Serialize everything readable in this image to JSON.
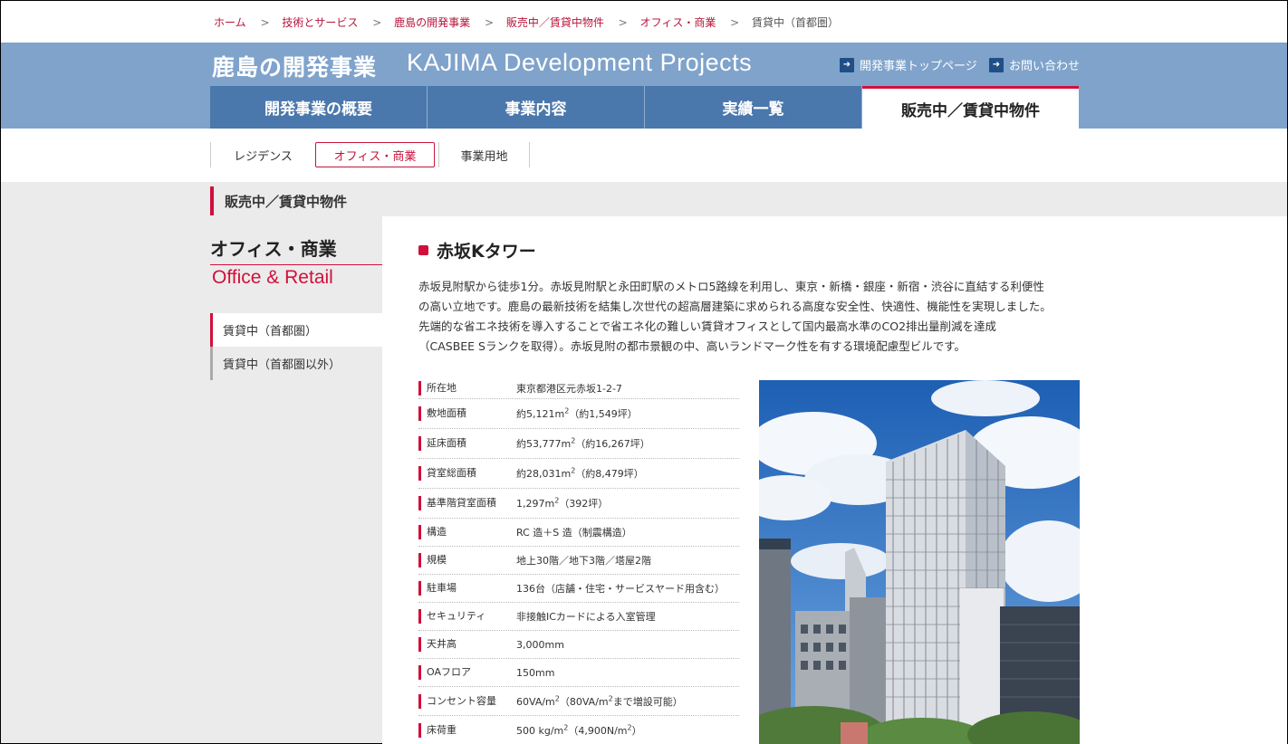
{
  "breadcrumb": {
    "items": [
      "ホーム",
      "技術とサービス",
      "鹿島の開発事業",
      "販売中／賃貸中物件",
      "オフィス・商業"
    ],
    "current": "賃貸中（首都圏）",
    "separator": ">"
  },
  "header": {
    "title_jp": "鹿島の開発事業",
    "title_en": "KAJIMA Development Projects",
    "links": [
      "開発事業トップページ",
      "お問い合わせ"
    ]
  },
  "global_nav": [
    "開発事業の概要",
    "事業内容",
    "実績一覧",
    "販売中／賃貸中物件"
  ],
  "sub_nav": [
    "レジデンス",
    "オフィス・商業",
    "事業用地"
  ],
  "section_heading": "販売中／賃貸中物件",
  "sidebar": {
    "title_jp": "オフィス・商業",
    "title_en": "Office & Retail",
    "items": [
      "賃貸中（首都圏）",
      "賃貸中（首都圏以外）"
    ]
  },
  "main": {
    "title": "赤坂Kタワー",
    "description": [
      "赤坂見附駅から徒歩1分。赤坂見附駅と永田町駅のメトロ5路線を利用し、東京・新橋・銀座・新宿・渋谷に直結する利便性",
      "の高い立地です。鹿島の最新技術を結集し次世代の超高層建築に求められる高度な安全性、快適性、機能性を実現しました。",
      "先端的な省エネ技術を導入することで省エネ化の難しい賃貸オフィスとして国内最高水準のCO2排出量削減を達成",
      "（CASBEE Sランクを取得）。赤坂見附の都市景観の中、高いランドマーク性を有する環境配慮型ビルです。"
    ],
    "specs": [
      {
        "key": "所在地",
        "val": "東京都港区元赤坂1-2-7"
      },
      {
        "key": "敷地面積",
        "pre": "約5,121m",
        "sup": "2",
        "post": "（約1,549坪）"
      },
      {
        "key": "延床面積",
        "pre": "約53,777m",
        "sup": "2",
        "post": "（約16,267坪）"
      },
      {
        "key": "貸室総面積",
        "pre": "約28,031m",
        "sup": "2",
        "post": "（約8,479坪）"
      },
      {
        "key": "基準階貸室面積",
        "pre": "1,297m",
        "sup": "2",
        "post": "（392坪）"
      },
      {
        "key": "構造",
        "val": "RC 造＋S 造（制震構造）"
      },
      {
        "key": "規模",
        "val": "地上30階／地下3階／塔屋2階"
      },
      {
        "key": "駐車場",
        "val": "136台（店舗・住宅・サービスヤード用含む）"
      },
      {
        "key": "セキュリティ",
        "val": "非接触ICカードによる入室管理"
      },
      {
        "key": "天井高",
        "val": "3,000mm"
      },
      {
        "key": "OAフロア",
        "val": "150mm"
      },
      {
        "key": "コンセント容量",
        "pre": "60VA/m",
        "sup": "2",
        "mid": "（80VA/m",
        "sup2": "2",
        "post": "まで増設可能）"
      },
      {
        "key": "床荷重",
        "pre": "500 kg/m",
        "sup": "2",
        "mid": "（4,900N/m",
        "sup2": "2",
        "post": "）"
      }
    ]
  },
  "colors": {
    "accent": "#d20f3c",
    "nav_blue": "#4b78ac",
    "band_blue": "#7fa3cb"
  }
}
